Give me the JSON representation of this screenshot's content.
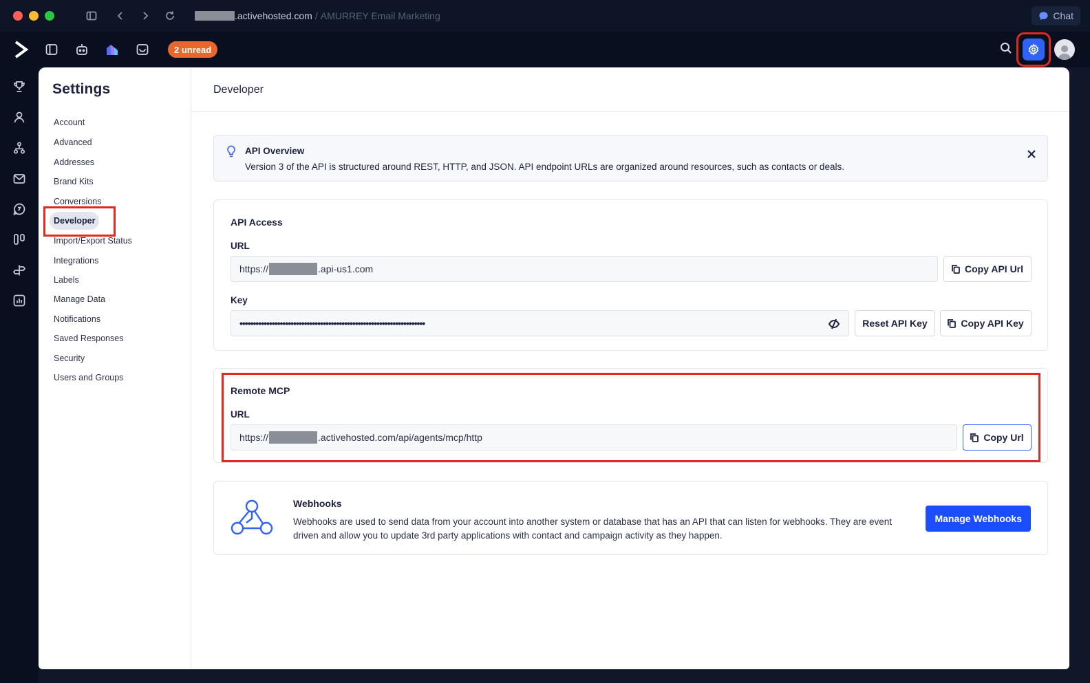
{
  "browser": {
    "url_domain": ".activehosted.com",
    "url_separator": "/",
    "tab_title": "AMURREY Email Marketing",
    "chat_label": "Chat"
  },
  "topbar": {
    "unread_badge": "2 unread"
  },
  "settings": {
    "title": "Settings",
    "nav": [
      "Account",
      "Advanced",
      "Addresses",
      "Brand Kits",
      "Conversions",
      "Developer",
      "Import/Export Status",
      "Integrations",
      "Labels",
      "Manage Data",
      "Notifications",
      "Saved Responses",
      "Security",
      "Users and Groups"
    ],
    "active_item": "Developer"
  },
  "developer": {
    "title": "Developer",
    "overview": {
      "title": "API Overview",
      "text": "Version 3 of the API is structured around REST, HTTP, and JSON. API endpoint URLs are organized around resources, such as contacts or deals."
    },
    "api_access": {
      "title": "API Access",
      "url_label": "URL",
      "url_prefix": "https://",
      "url_suffix": ".api-us1.com",
      "copy_url_label": "Copy API Url",
      "key_label": "Key",
      "key_masked": "•••••••••••••••••••••••••••••••••••••••••••••••••••••••••••••••••••••",
      "reset_key_label": "Reset API Key",
      "copy_key_label": "Copy API Key"
    },
    "remote_mcp": {
      "title": "Remote MCP",
      "url_label": "URL",
      "url_prefix": "https://",
      "url_suffix": ".activehosted.com/api/agents/mcp/http",
      "copy_label": "Copy Url"
    },
    "webhooks": {
      "title": "Webhooks",
      "text": "Webhooks are used to send data from your account into another system or database that has an API that can listen for webhooks. They are event driven and allow you to update 3rd party applications with contact and campaign activity as they happen.",
      "button_label": "Manage Webhooks"
    }
  },
  "colors": {
    "accent": "#2f63f6",
    "primary_button": "#1c4dfa",
    "badge": "#e8672c",
    "highlight": "#e3291d",
    "chrome_bg": "#0a0f1f"
  }
}
